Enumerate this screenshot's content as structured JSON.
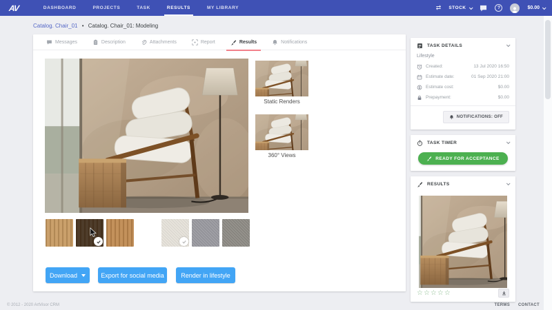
{
  "navbar": {
    "logo": "AV",
    "items": [
      {
        "label": "DASHBOARD",
        "active": false
      },
      {
        "label": "PROJECTS",
        "active": false
      },
      {
        "label": "TASK",
        "active": false
      },
      {
        "label": "RESULTS",
        "active": true
      },
      {
        "label": "MY LIBRARY",
        "active": false
      }
    ],
    "stock_label": "STOCK",
    "balance": "$0.00"
  },
  "breadcrumb": {
    "parent": "Catalog. Chair_01",
    "separator": "•",
    "current": "Catalog. Chair_01: Modeling"
  },
  "tabs": [
    {
      "label": "Messages"
    },
    {
      "label": "Description"
    },
    {
      "label": "Attachments"
    },
    {
      "label": "Report"
    },
    {
      "label": "Results"
    },
    {
      "label": "Notifications"
    }
  ],
  "gallery": {
    "static_renders_label": "Static Renders",
    "views_label": "360° Views"
  },
  "materials": {
    "wood": [
      {
        "name": "light-oak",
        "color": "#c79b63",
        "selected": false
      },
      {
        "name": "dark-walnut",
        "color": "#45321f",
        "selected": true
      },
      {
        "name": "medium-oak",
        "color": "#c08b52",
        "selected": false
      }
    ],
    "fabric": [
      {
        "name": "cream",
        "color": "#e9e5dd",
        "selected": true
      },
      {
        "name": "grey",
        "color": "#9b9ba1",
        "selected": false
      },
      {
        "name": "taupe",
        "color": "#8f8c86",
        "selected": false
      }
    ]
  },
  "actions": {
    "download": "Download",
    "export": "Export for social media",
    "render": "Render in lifestyle"
  },
  "task_details": {
    "title": "TASK DETAILS",
    "category": "Lifestyle",
    "rows": [
      {
        "label": "Created:",
        "value": "13 Jul 2020 16:50"
      },
      {
        "label": "Estimate date:",
        "value": "01 Sep 2020 21:00"
      },
      {
        "label": "Estimate cost:",
        "value": "$0.00"
      },
      {
        "label": "Prepayment:",
        "value": "$0.00"
      }
    ],
    "notifications_button": "NOTIFICATIONS: OFF"
  },
  "task_timer": {
    "title": "TASK TIMER",
    "accept_button": "READY FOR ACCEPTANCE"
  },
  "results_panel": {
    "title": "RESULTS",
    "stars": "☆☆☆☆☆"
  },
  "footer": {
    "copyright": "© 2012 - 2020 ArtVisor CRM",
    "terms": "TERMS",
    "contact": "CONTACT"
  },
  "colors": {
    "navbar_blue": "#3f51b5",
    "action_blue": "#42a5f5",
    "accept_green": "#4cb050",
    "tab_underline_pink": "#f2808a",
    "link_blue": "#5467c6"
  }
}
